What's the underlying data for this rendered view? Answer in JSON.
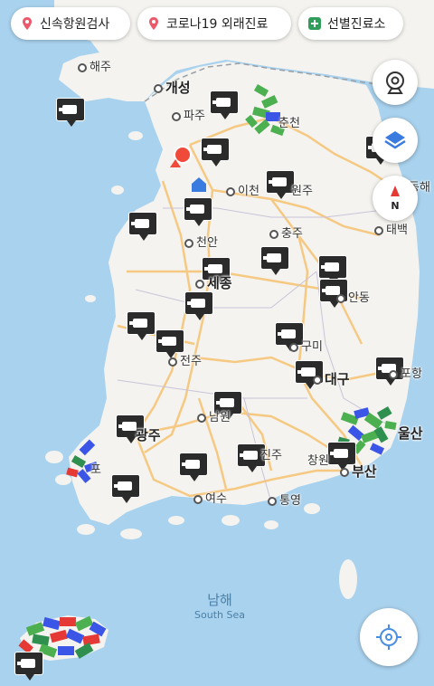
{
  "filters": [
    {
      "label": "신속항원검사",
      "icon": "pin-icon",
      "color": "#ea5a6a"
    },
    {
      "label": "코로나19 외래진료",
      "icon": "pin-icon",
      "color": "#ea5a6a"
    },
    {
      "label": "선별진료소",
      "icon": "plus-icon",
      "color": "#2f9e5a"
    }
  ],
  "cities": {
    "haeju": "해주",
    "gaeseong": "개성",
    "paju": "파주",
    "chuncheon": "춘천",
    "icheon": "이천",
    "wonju": "원주",
    "donghae": "동해",
    "taebaek": "태백",
    "cheonan": "천안",
    "chungju": "충주",
    "sejong": "세종",
    "andong": "안동",
    "gumi": "구미",
    "jeonju": "전주",
    "daegu": "대구",
    "pohang": "포항",
    "namwon": "남원",
    "gwangju": "광주",
    "ulsan": "울산",
    "mokpo": "포",
    "jinju": "진주",
    "changwon": "창원",
    "busan": "부산",
    "yeosu": "여수",
    "tongyeong": "통영"
  },
  "sea": {
    "name_ko": "남해",
    "name_en": "South Sea"
  },
  "colors": {
    "water": "#a9d2ee",
    "land": "#f4f3ef",
    "highway": "#f6c983",
    "border": "#9aa0a6",
    "location": "#f04b3a"
  }
}
